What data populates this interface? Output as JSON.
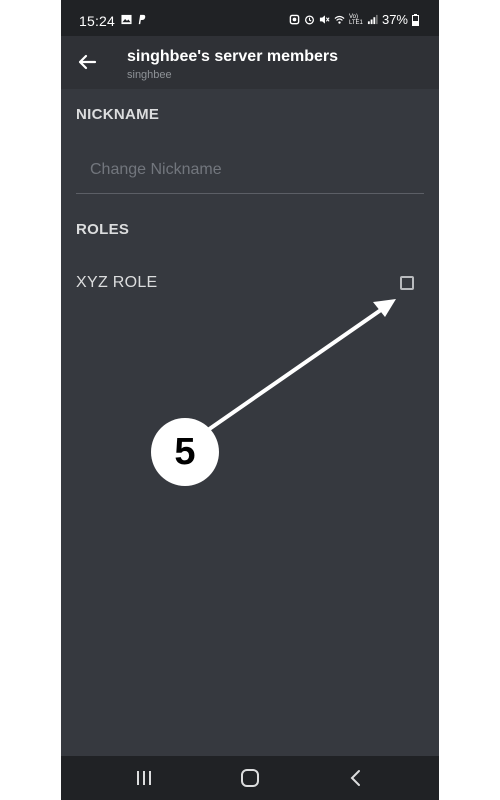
{
  "status_bar": {
    "time": "15:24",
    "network_label": "Vo) LTE1",
    "battery_percent": "37%"
  },
  "header": {
    "title": "singhbee's server members",
    "subtitle": "singhbee"
  },
  "nickname": {
    "section_label": "NICKNAME",
    "placeholder": "Change Nickname",
    "value": ""
  },
  "roles": {
    "section_label": "ROLES",
    "items": [
      {
        "name": "XYZ ROLE",
        "checked": false
      }
    ]
  },
  "annotation": {
    "step_number": "5"
  },
  "colors": {
    "background": "#36393f",
    "header": "#2f3136",
    "status_bar": "#202225",
    "text": "#dcddde",
    "muted": "#72767d"
  },
  "icons": {
    "back": "arrow-left-icon",
    "nav_recents": "recents-icon",
    "nav_home": "home-icon",
    "nav_back": "chevron-left-icon"
  }
}
